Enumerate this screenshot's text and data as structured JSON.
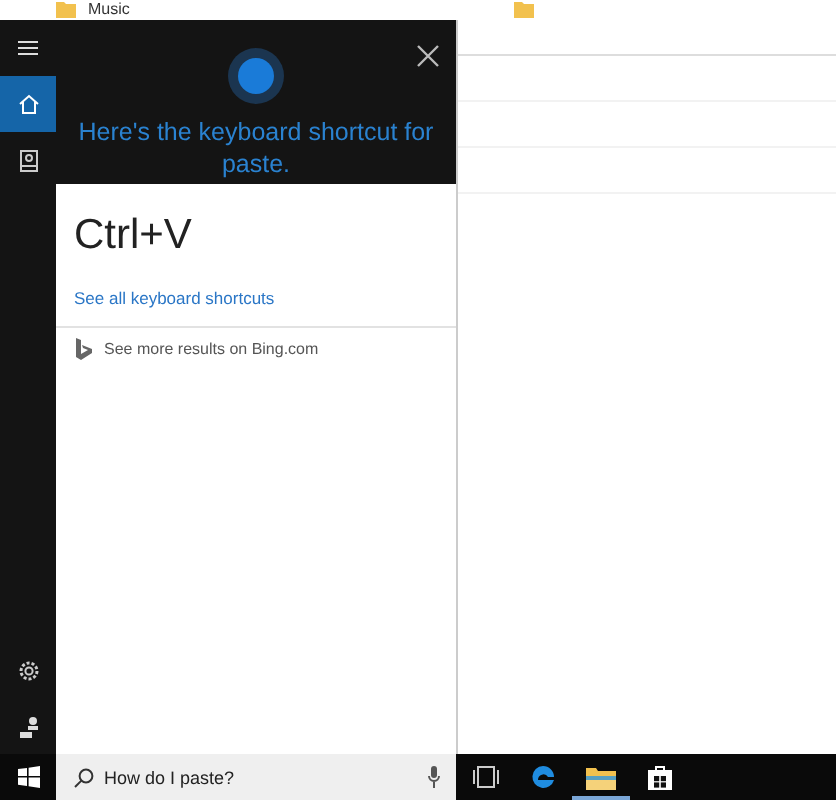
{
  "background": {
    "folder_label": "Music",
    "icons": [
      {
        "kind": "folder"
      },
      {
        "kind": "folder"
      }
    ]
  },
  "rail": {
    "top": [
      {
        "kind": "menu",
        "selected": false
      },
      {
        "kind": "home",
        "selected": true
      },
      {
        "kind": "notebook",
        "selected": false
      }
    ],
    "bottom": [
      {
        "kind": "settings"
      },
      {
        "kind": "feedback"
      }
    ]
  },
  "answer": {
    "heading": "Here's the keyboard shortcut for paste.",
    "shortcut": "Ctrl+V",
    "link": "See all keyboard shortcuts",
    "bing": "See more results on Bing.com"
  },
  "taskbar": {
    "search": {
      "value": "How do I paste?"
    },
    "apps": [
      {
        "kind": "task-view",
        "running": false
      },
      {
        "kind": "edge",
        "running": false
      },
      {
        "kind": "explorer",
        "running": true
      },
      {
        "kind": "store",
        "running": false
      }
    ]
  }
}
